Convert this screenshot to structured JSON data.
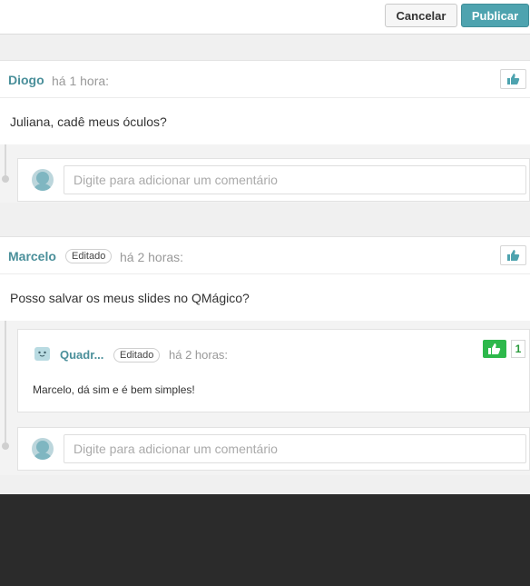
{
  "toolbar": {
    "cancel_label": "Cancelar",
    "publish_label": "Publicar"
  },
  "comments": [
    {
      "author": "Diogo",
      "time": "há 1 hora:",
      "text": "Juliana, cadê meus óculos?",
      "reply_placeholder": "Digite para adicionar um comentário"
    },
    {
      "author": "Marcelo",
      "edited_label": "Editado",
      "time": "há 2 horas:",
      "text": "Posso salvar os meus slides no QMágico?",
      "replies": [
        {
          "author": "Quadr...",
          "edited_label": "Editado",
          "time": "há 2 horas:",
          "text": "Marcelo, dá sim e é bem simples!",
          "likes": "1"
        }
      ],
      "reply_placeholder": "Digite para adicionar um comentário"
    }
  ],
  "colors": {
    "accent": "#4ea3af",
    "like_active": "#2db84b",
    "author": "#4a8f9a"
  }
}
